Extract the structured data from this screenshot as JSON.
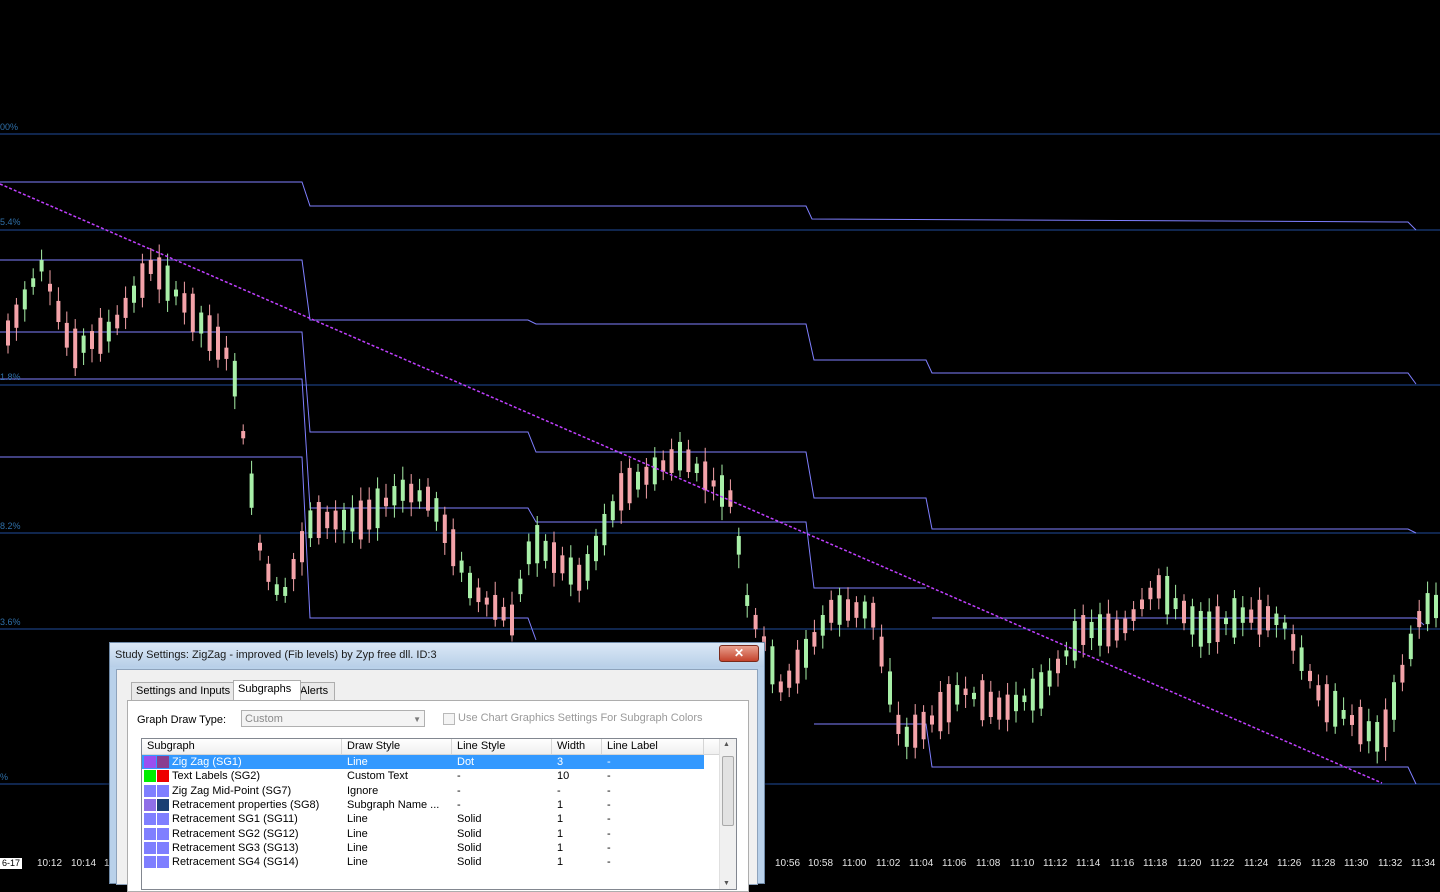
{
  "chart": {
    "date_tag": "6-17",
    "fib_labels": [
      "00%",
      "5.4%",
      "1.8%",
      "8.2%",
      "3.6%",
      "%"
    ],
    "time_ticks": [
      "10:12",
      "10:14",
      "1",
      "10:56",
      "10:58",
      "11:00",
      "11:02",
      "11:04",
      "11:06",
      "11:08",
      "11:10",
      "11:12",
      "11:14",
      "11:16",
      "11:18",
      "11:20",
      "11:22",
      "11:24",
      "11:26",
      "11:28",
      "11:30",
      "11:32",
      "11:34"
    ],
    "colors": {
      "background": "#000000",
      "up_candle": "#a8f0a8",
      "down_candle": "#f4a3a9",
      "zigzag": "#c040ff",
      "fib_line": "#1f4c9c",
      "retracement_line": "#7f7fff"
    }
  },
  "dialog": {
    "title": "Study Settings: ZigZag - improved (Fib levels) by Zyp free dll. ID:3",
    "close_label": "✕",
    "tabs": [
      "Settings and Inputs",
      "Subgraphs",
      "Alerts"
    ],
    "active_tab": "Subgraphs",
    "graph_draw_type_label": "Graph Draw Type:",
    "graph_draw_type_value": "Custom",
    "use_chart_graphics_label": "Use Chart Graphics Settings For Subgraph Colors",
    "columns": [
      "Subgraph",
      "Draw Style",
      "Line Style",
      "Width",
      "Line Label"
    ],
    "rows": [
      {
        "name": "Zig Zag (SG1)",
        "draw_style": "Line",
        "line_style": "Dot",
        "width": "3",
        "label": "-",
        "c1": "#9a4ff0",
        "c2": "#8a3f8f",
        "selected": true
      },
      {
        "name": "Text Labels (SG2)",
        "draw_style": "Custom Text",
        "line_style": "-",
        "width": "10",
        "label": "-",
        "c1": "#00ee00",
        "c2": "#ee0000",
        "selected": false
      },
      {
        "name": "Zig Zag Mid-Point (SG7)",
        "draw_style": "Ignore",
        "line_style": "-",
        "width": "-",
        "label": "-",
        "c1": "#7f7fff",
        "c2": "#7f7fff",
        "selected": false
      },
      {
        "name": "Retracement properties (SG8)",
        "draw_style": "Subgraph Name ...",
        "line_style": "-",
        "width": "1",
        "label": "-",
        "c1": "#8f6fe8",
        "c2": "#1a3f73",
        "selected": false
      },
      {
        "name": "Retracement SG1 (SG11)",
        "draw_style": "Line",
        "line_style": "Solid",
        "width": "1",
        "label": "-",
        "c1": "#7f7fff",
        "c2": "#7f7fff",
        "selected": false
      },
      {
        "name": "Retracement SG2 (SG12)",
        "draw_style": "Line",
        "line_style": "Solid",
        "width": "1",
        "label": "-",
        "c1": "#7f7fff",
        "c2": "#7f7fff",
        "selected": false
      },
      {
        "name": "Retracement SG3 (SG13)",
        "draw_style": "Line",
        "line_style": "Solid",
        "width": "1",
        "label": "-",
        "c1": "#7f7fff",
        "c2": "#7f7fff",
        "selected": false
      },
      {
        "name": "Retracement SG4 (SG14)",
        "draw_style": "Line",
        "line_style": "Solid",
        "width": "1",
        "label": "-",
        "c1": "#7f7fff",
        "c2": "#7f7fff",
        "selected": false
      }
    ]
  }
}
